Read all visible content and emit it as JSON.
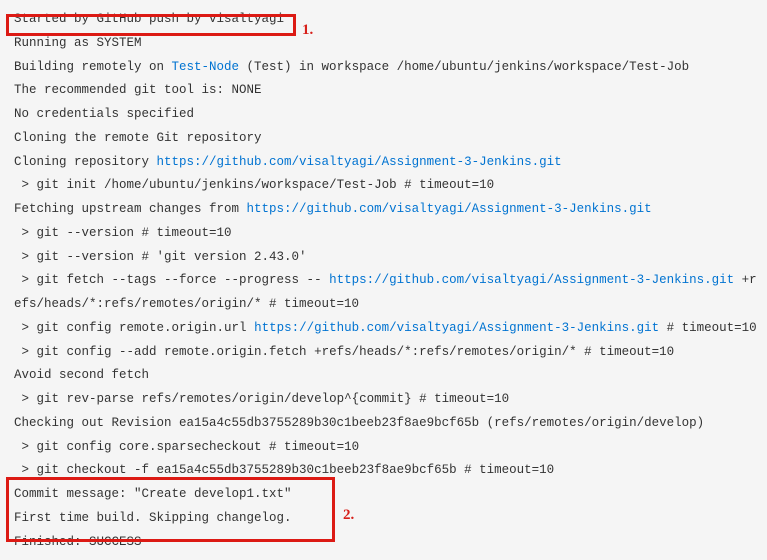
{
  "annotations": {
    "label1": "1.",
    "label2": "2."
  },
  "log": {
    "line1": "Started by GitHub push by visaltyagi",
    "line2": "Running as SYSTEM",
    "line3_a": "Building remotely on ",
    "line3_link": "Test-Node",
    "line3_b": " (Test) in workspace /home/ubuntu/jenkins/workspace/Test-Job",
    "line4": "The recommended git tool is: NONE",
    "line5": "No credentials specified",
    "line6": "Cloning the remote Git repository",
    "line7_a": "Cloning repository ",
    "line7_link": "https://github.com/visaltyagi/Assignment-3-Jenkins.git",
    "line8": " > git init /home/ubuntu/jenkins/workspace/Test-Job # timeout=10",
    "line9_a": "Fetching upstream changes from ",
    "line9_link": "https://github.com/visaltyagi/Assignment-3-Jenkins.git",
    "line10": " > git --version # timeout=10",
    "line11": " > git --version # 'git version 2.43.0'",
    "line12_a": " > git fetch --tags --force --progress -- ",
    "line12_link": "https://github.com/visaltyagi/Assignment-3-Jenkins.git",
    "line12_b": " +refs/heads/*:refs/remotes/origin/* # timeout=10",
    "line13_a": " > git config remote.origin.url ",
    "line13_link": "https://github.com/visaltyagi/Assignment-3-Jenkins.git",
    "line13_b": " # timeout=10",
    "line14": " > git config --add remote.origin.fetch +refs/heads/*:refs/remotes/origin/* # timeout=10",
    "line15": "Avoid second fetch",
    "line16": " > git rev-parse refs/remotes/origin/develop^{commit} # timeout=10",
    "line17": "Checking out Revision ea15a4c55db3755289b30c1beeb23f8ae9bcf65b (refs/remotes/origin/develop)",
    "line18": " > git config core.sparsecheckout # timeout=10",
    "line19": " > git checkout -f ea15a4c55db3755289b30c1beeb23f8ae9bcf65b # timeout=10",
    "line20": "Commit message: \"Create develop1.txt\"",
    "line21": "First time build. Skipping changelog.",
    "line22": "Finished: SUCCESS"
  }
}
